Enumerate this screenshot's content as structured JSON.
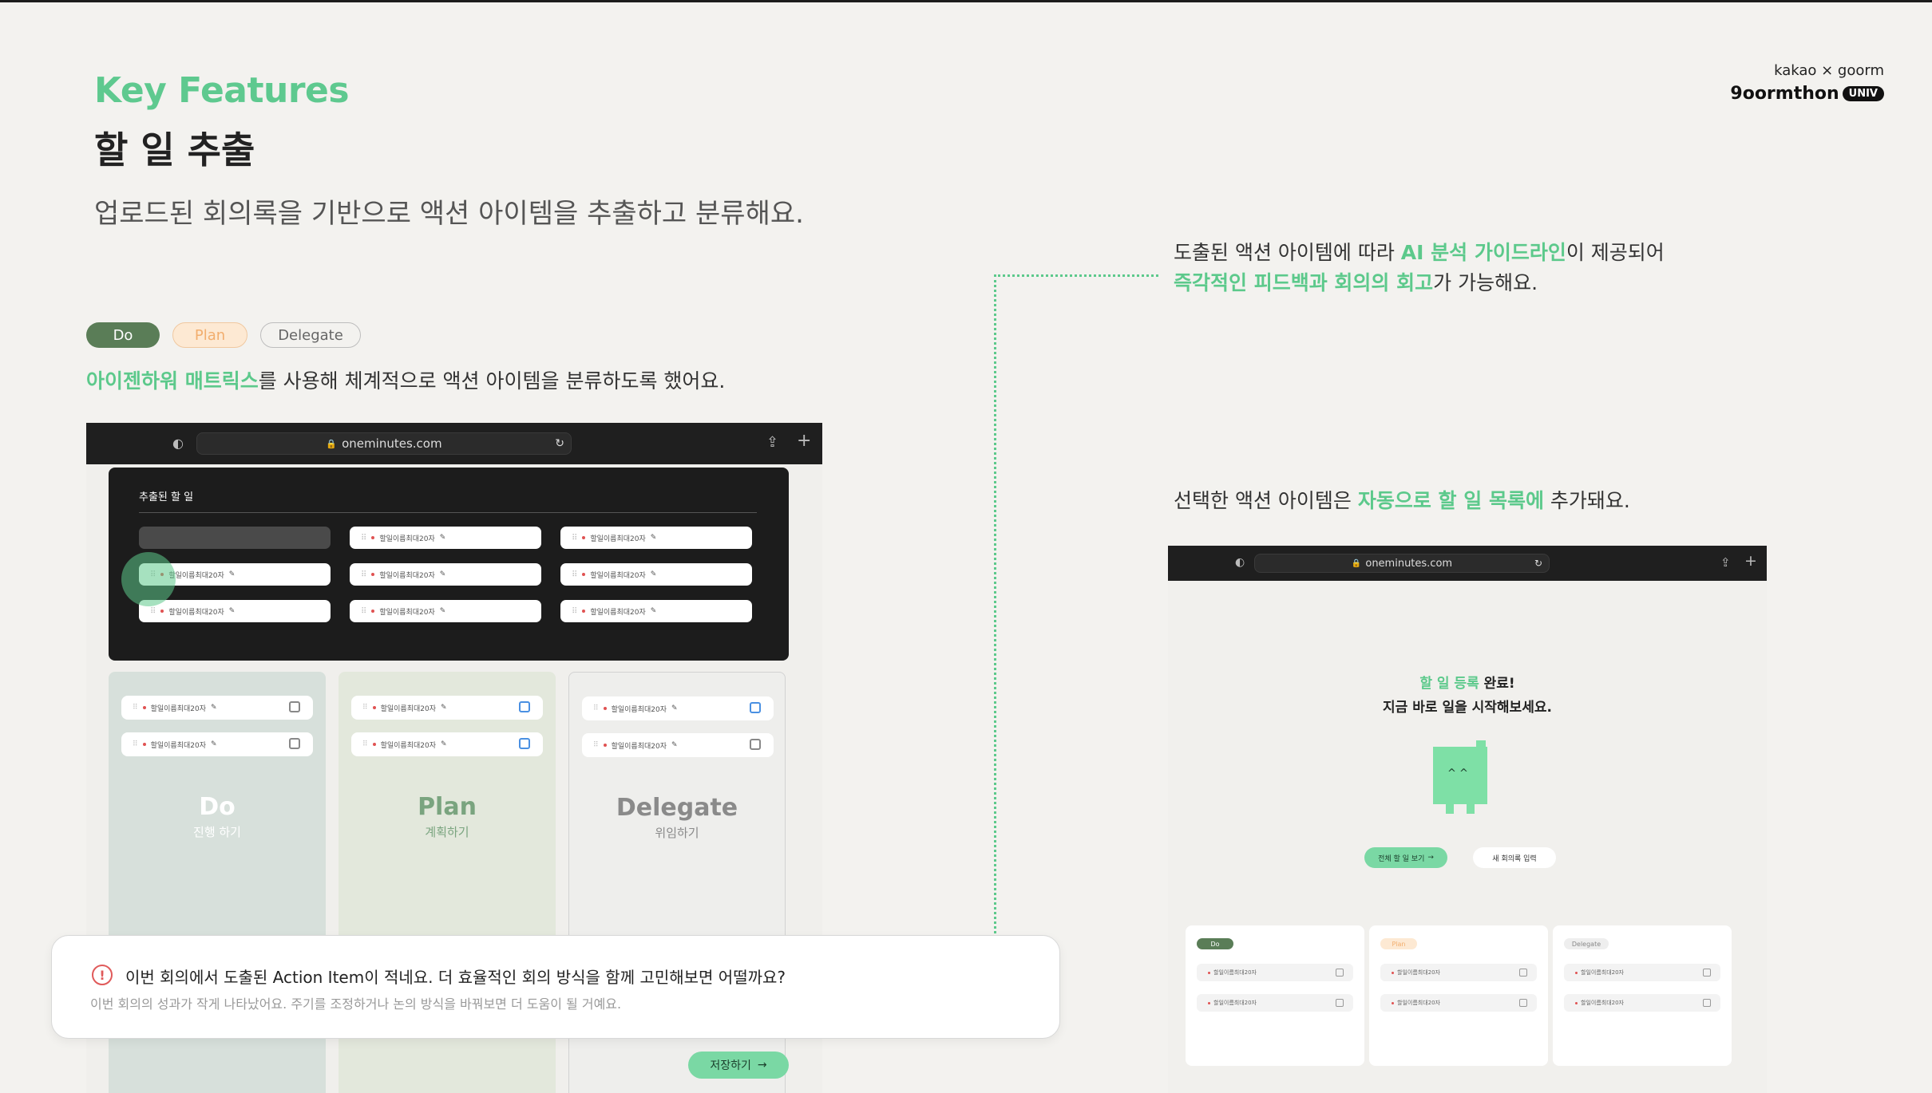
{
  "header": {
    "kicker": "Key Features",
    "title": "할 일 추출",
    "subtitle": "업로드된 회의록을 기반으로 액션 아이템을 추출하고 분류해요."
  },
  "brand": {
    "line1": "kakao × goorm",
    "line2": "9oormthon",
    "badge": "UNIV"
  },
  "chips": {
    "do": "Do",
    "plan": "Plan",
    "delegate": "Delegate"
  },
  "matrix_text": {
    "highlight": "아이젠하워 매트릭스",
    "rest": "를 사용해 체계적으로 액션 아이템을 분류하도록 했어요."
  },
  "browser": {
    "url": "oneminutes.com"
  },
  "extract": {
    "title": "추출된 할 일",
    "item": "할일이름최대20자"
  },
  "columns": [
    {
      "title": "Do",
      "subtitle": "진행 하기",
      "bg": "#d7e0db",
      "fg": "#ffffff",
      "sfg": "#ffffff"
    },
    {
      "title": "Plan",
      "subtitle": "계획하기",
      "bg": "#e3e8dc",
      "fg": "#7aa47f",
      "sfg": "#7aa47f"
    },
    {
      "title": "Delegate",
      "subtitle": "위임하기",
      "bg": "#eeeeec",
      "fg": "#8a8a8a",
      "sfg": "#8a8a8a"
    }
  ],
  "save_button": "저장하기",
  "alert": {
    "title": "이번 회의에서 도출된 Action Item이 적네요. 더 효율적인 회의 방식을 함께 고민해보면 어떨까요?",
    "sub": "이번 회의의 성과가 작게 나타났어요. 주기를 조정하거나 논의 방식을 바꿔보면 더 도움이 될 거예요."
  },
  "right_text1": {
    "l1a": "도출된 액션 아이템에 따라 ",
    "l1b": "AI 분석 가이드라인",
    "l1c": "이 제공되어",
    "l2a": "즉각적인 피드백과 회의의 회고",
    "l2b": "가 가능해요."
  },
  "right_text2": {
    "a": "선택한 액션 아이템은 ",
    "b": "자동으로 할 일 목록에",
    "c": " 추가돼요."
  },
  "done": {
    "l1a": "할 일 등록",
    "l1b": " 완료!",
    "l2": "지금 바로 일을 시작해보세요.",
    "btn_all": "전체 할 일 보기",
    "btn_new": "새 회의록 입력"
  },
  "mini": {
    "do": "Do",
    "plan": "Plan",
    "delegate": "Delegate",
    "item": "할일이름최대20자"
  },
  "colors": {
    "accent": "#5cc98b",
    "do_chip": "#5a7d57",
    "plan_chip": "#fde9d3"
  }
}
